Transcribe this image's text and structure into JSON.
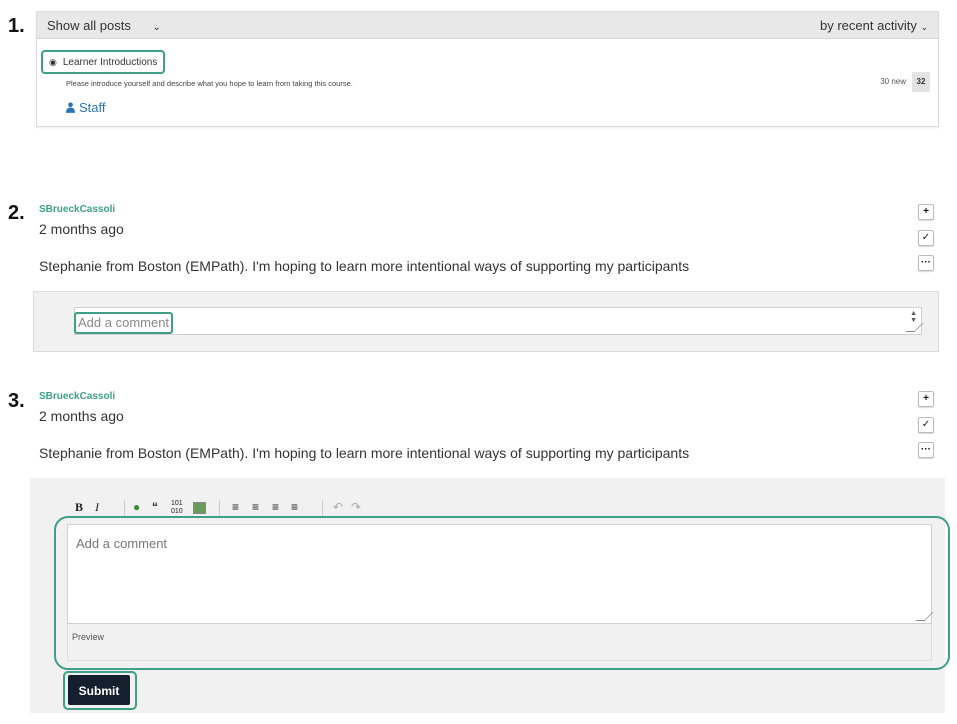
{
  "steps": [
    "1.",
    "2.",
    "3."
  ],
  "filter_bar": {
    "filter_label": "Show all posts",
    "sort_label": "by recent activity"
  },
  "topic": {
    "title": "Learner Introductions",
    "description": "Please introduce yourself and describe what you hope to learn from taking this course.",
    "author_role": "Staff",
    "new_count": "30 new",
    "total_count": "32"
  },
  "post1": {
    "author": "SBrueckCassoli",
    "time": "2 months ago",
    "body": "Stephanie from Boston (EMPath). I'm hoping to learn more intentional ways of supporting my participants",
    "comment_placeholder": "Add a comment"
  },
  "post2": {
    "author": "SBrueckCassoli",
    "time": "2 months ago",
    "body": "Stephanie from Boston (EMPath). I'm hoping to learn more intentional ways of supporting my participants"
  },
  "editor": {
    "placeholder": "Add a comment",
    "preview_label": "Preview",
    "submit_label": "Submit"
  },
  "colors": {
    "accent": "#3e9f86",
    "link": "#2a74b5",
    "submit_bg": "#14202e"
  }
}
